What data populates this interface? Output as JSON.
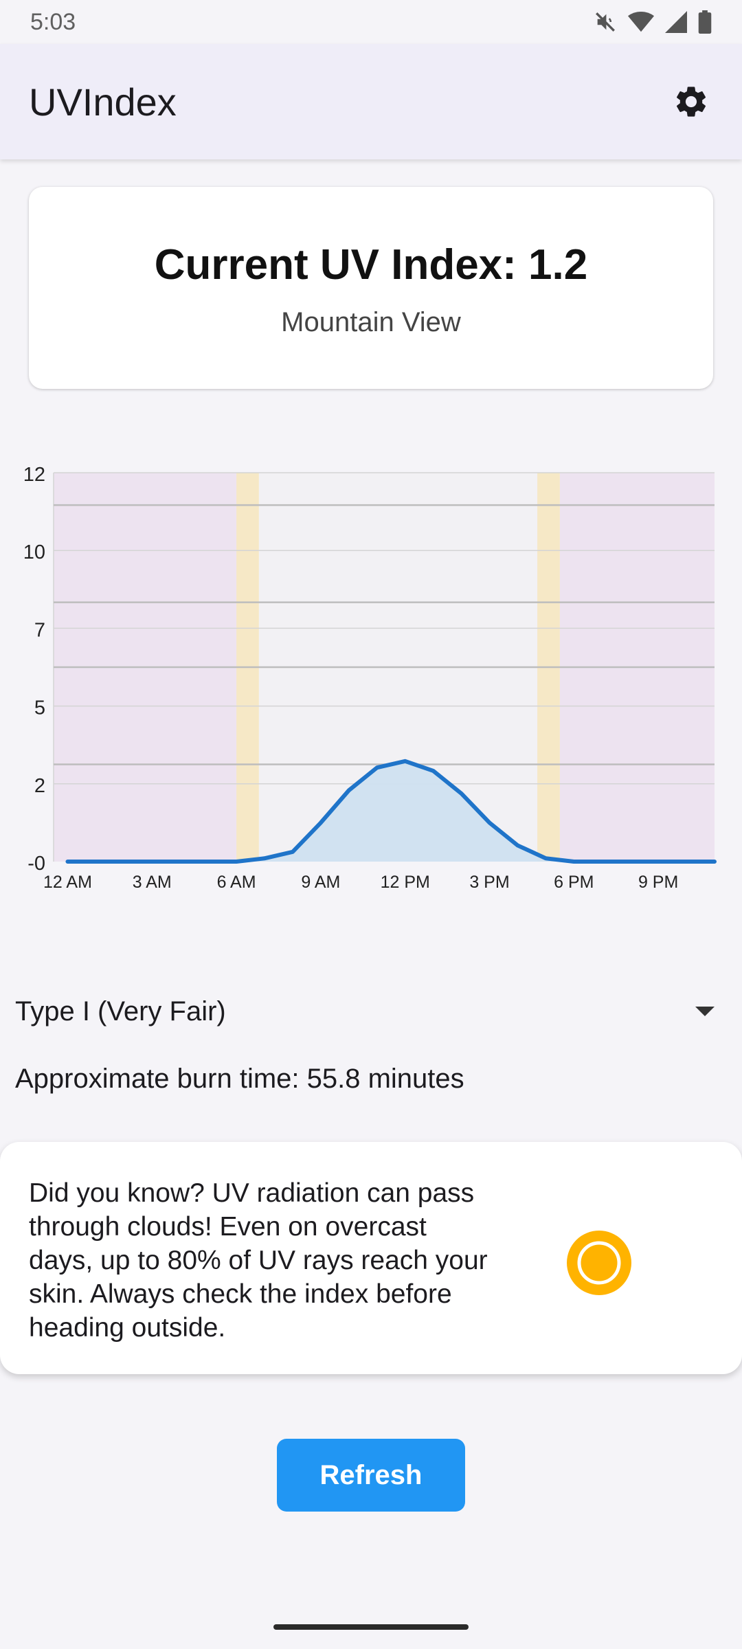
{
  "status_bar": {
    "time": "5:03"
  },
  "app_bar": {
    "title": "UVIndex",
    "settings_icon": "gear-icon"
  },
  "uv_card": {
    "title": "Current UV Index: 1.2",
    "location": "Mountain View"
  },
  "chart_data": {
    "type": "area",
    "x": [
      0,
      1,
      2,
      3,
      4,
      5,
      6,
      7,
      8,
      9,
      10,
      11,
      12,
      13,
      14,
      15,
      16,
      17,
      18,
      19,
      20,
      21,
      22,
      23
    ],
    "series": [
      {
        "values": [
          0,
          0,
          0,
          0,
          0,
          0,
          0,
          0.1,
          0.3,
          1.2,
          2.2,
          2.9,
          3.1,
          2.8,
          2.1,
          1.2,
          0.5,
          0.1,
          0,
          0,
          0,
          0,
          0,
          0
        ]
      }
    ],
    "x_tick_labels": [
      "12 AM",
      "3 AM",
      "6 AM",
      "9 AM",
      "12 PM",
      "3 PM",
      "6 PM",
      "9 PM"
    ],
    "x_tick_hours": [
      0,
      3,
      6,
      9,
      12,
      15,
      18,
      21
    ],
    "y_tick_labels": [
      "-0",
      "2",
      "5",
      "7",
      "10",
      "12"
    ],
    "y_tick_values": [
      0,
      2.4,
      4.8,
      7.2,
      9.6,
      12
    ],
    "ylim": [
      0,
      12
    ],
    "xlim": [
      -0.5,
      23
    ],
    "uv_threshold_lines": [
      3,
      6,
      8,
      11
    ],
    "night_periods": [
      [
        -0.5,
        6
      ],
      [
        17.5,
        23
      ]
    ],
    "twilight_periods": [
      [
        6,
        6.8
      ],
      [
        16.7,
        17.5
      ]
    ],
    "colors": {
      "line": "#1f74c9",
      "fill": "#cfe0f0",
      "night": "#ede3f0",
      "twilight": "#f6e8c6",
      "day": "#f2f1f4",
      "grid": "#d4d4d4",
      "threshold": "#bdbdbd"
    },
    "grid": true,
    "legend": false
  },
  "skin_type": {
    "selected": "Type I (Very Fair)"
  },
  "burn_time": "Approximate burn time: 55.8 minutes",
  "tip": {
    "text": "Did you know? UV radiation can pass through clouds! Even on overcast days, up to 80% of UV rays reach your skin. Always check the index before heading outside.",
    "icon": "sun-icon",
    "icon_color": "#ffb300"
  },
  "refresh_label": "Refresh"
}
